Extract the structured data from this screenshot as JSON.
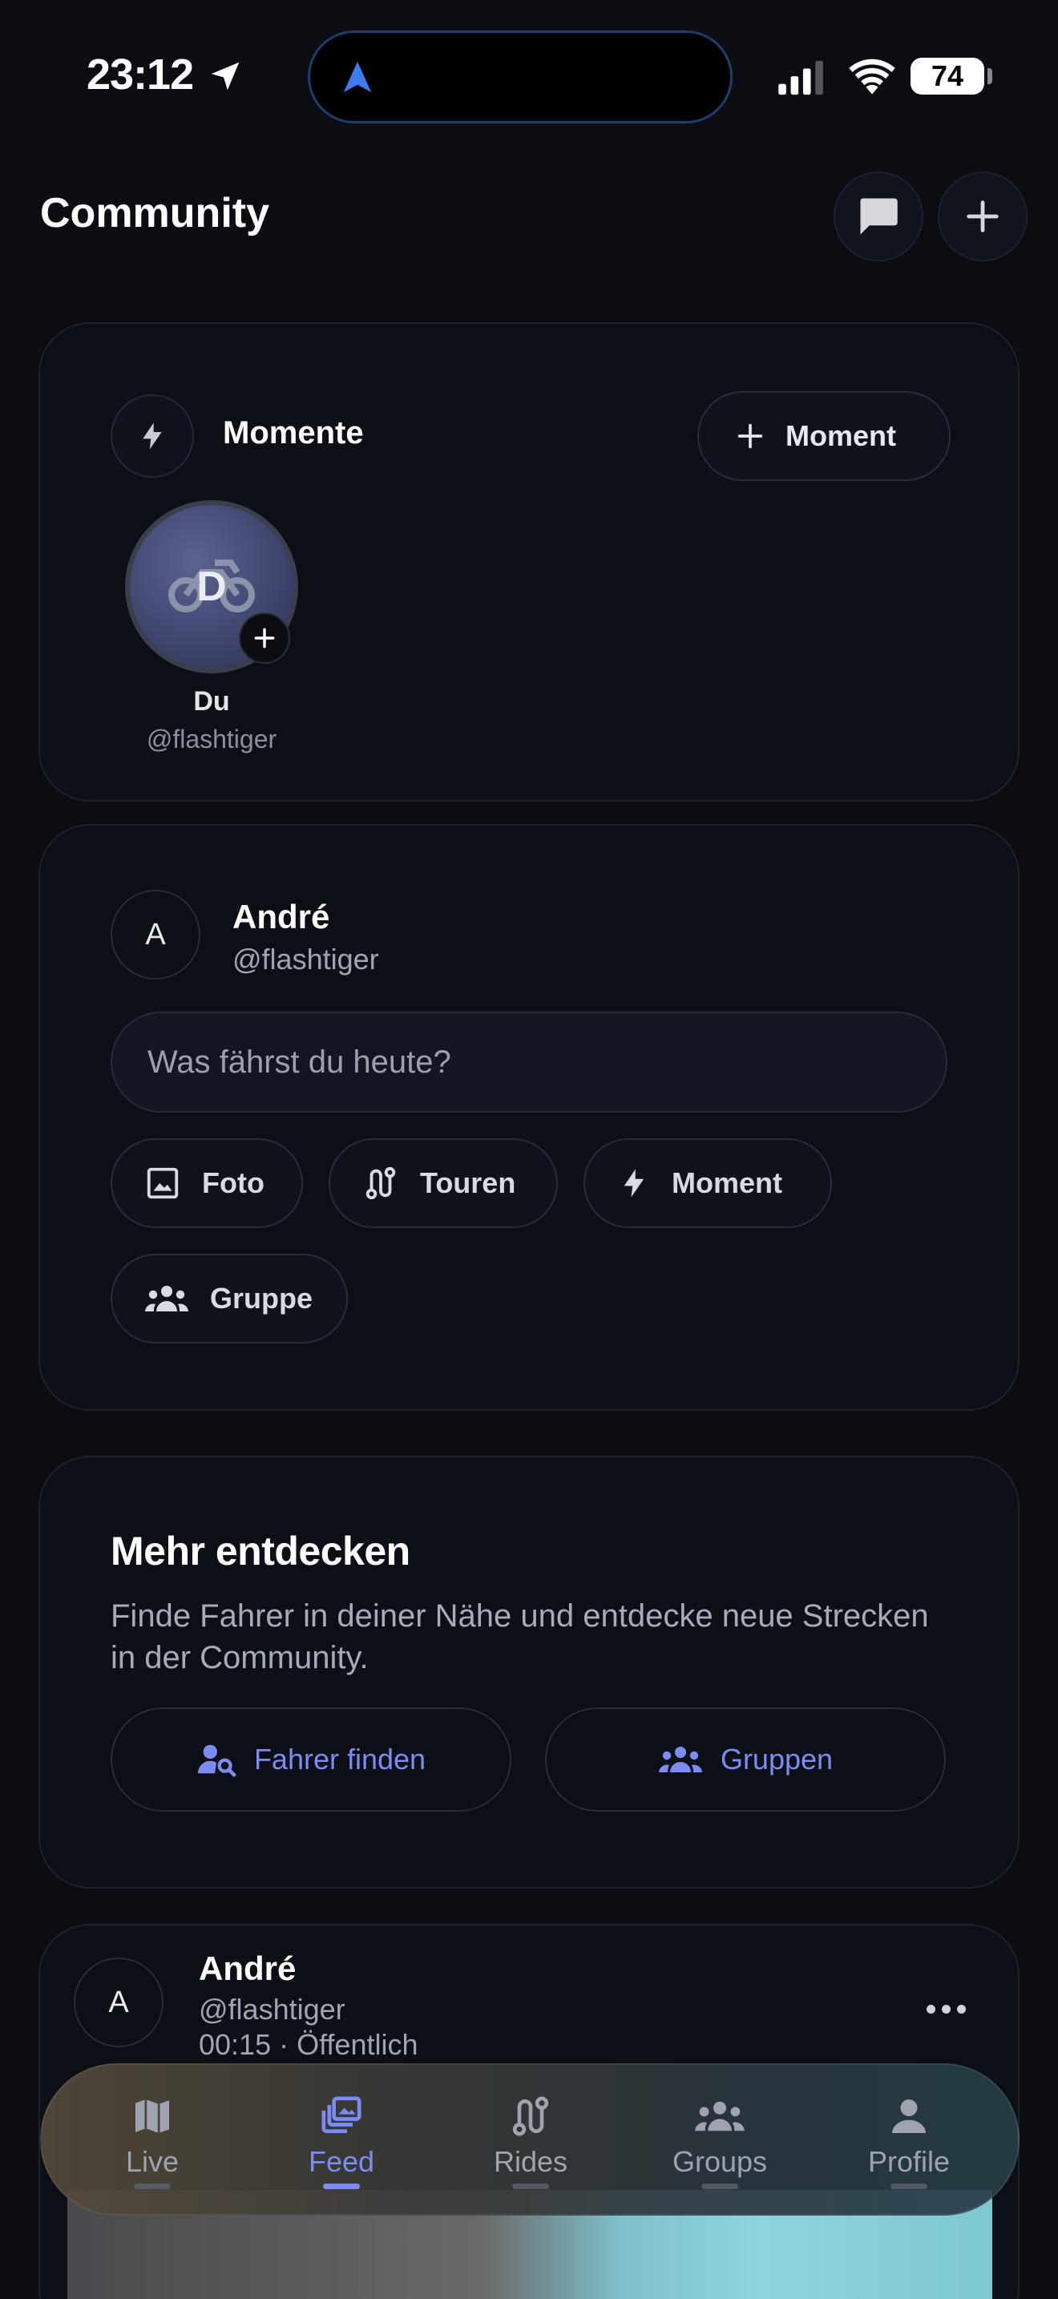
{
  "status_bar": {
    "time": "23:12",
    "battery": "74"
  },
  "header": {
    "title": "Community"
  },
  "moments": {
    "title": "Momente",
    "add_label": "Moment",
    "story": {
      "initial": "D",
      "name": "Du",
      "handle": "@flashtiger"
    }
  },
  "composer": {
    "user": {
      "initial": "A",
      "name": "André",
      "handle": "@flashtiger"
    },
    "placeholder": "Was fährst du heute?",
    "actions": [
      {
        "label": "Foto",
        "icon": "image-icon"
      },
      {
        "label": "Touren",
        "icon": "route-icon"
      },
      {
        "label": "Moment",
        "icon": "bolt-icon"
      },
      {
        "label": "Gruppe",
        "icon": "group-icon"
      }
    ]
  },
  "discover": {
    "title": "Mehr entdecken",
    "description": "Finde Fahrer in deiner Nähe und entdecke neue Strecken in der Community.",
    "find_riders": "Fahrer finden",
    "groups": "Gruppen",
    "accent": "#7d8cf5"
  },
  "post": {
    "initial": "A",
    "name": "André",
    "handle": "@flashtiger",
    "meta": "00:15 · Öffentlich"
  },
  "tabbar": {
    "active": "Feed",
    "accent": "#7b8cf3",
    "tabs": [
      {
        "label": "Live",
        "icon": "map-icon"
      },
      {
        "label": "Feed",
        "icon": "feed-icon"
      },
      {
        "label": "Rides",
        "icon": "route-icon"
      },
      {
        "label": "Groups",
        "icon": "group-icon"
      },
      {
        "label": "Profile",
        "icon": "person-icon"
      }
    ]
  }
}
